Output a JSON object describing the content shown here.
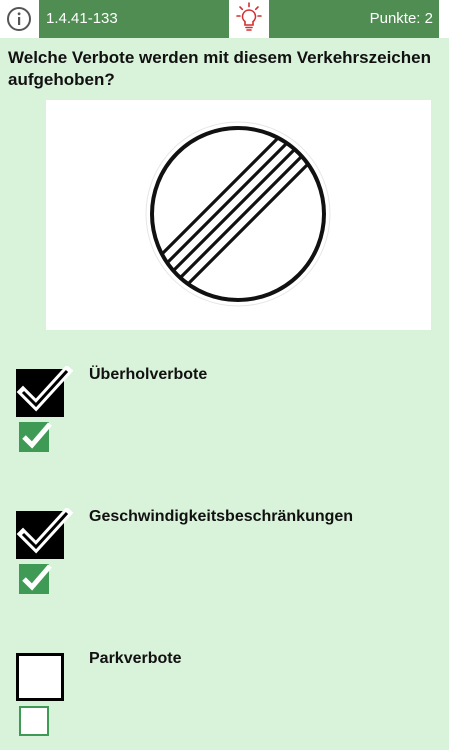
{
  "header": {
    "question_id": "1.4.41-133",
    "points": "Punkte: 2",
    "info_icon": "info-icon",
    "hint_icon": "lightbulb-icon"
  },
  "question": {
    "text": "Welche Verbote werden mit diesem Verkehrszeichen aufgehoben?"
  },
  "sign": {
    "icon": "end-of-all-restrictions-sign"
  },
  "answers": [
    {
      "label": "Überholverbote",
      "user_checked": true,
      "correct_checked": true
    },
    {
      "label": "Geschwindigkeitsbeschränkungen",
      "user_checked": true,
      "correct_checked": true
    },
    {
      "label": "Parkverbote",
      "user_checked": false,
      "correct_checked": false
    }
  ],
  "colors": {
    "background": "#d9f2da",
    "header_green": "#4f8d52",
    "correct_green": "#3f9a55",
    "hint_red": "#d32f2f"
  }
}
